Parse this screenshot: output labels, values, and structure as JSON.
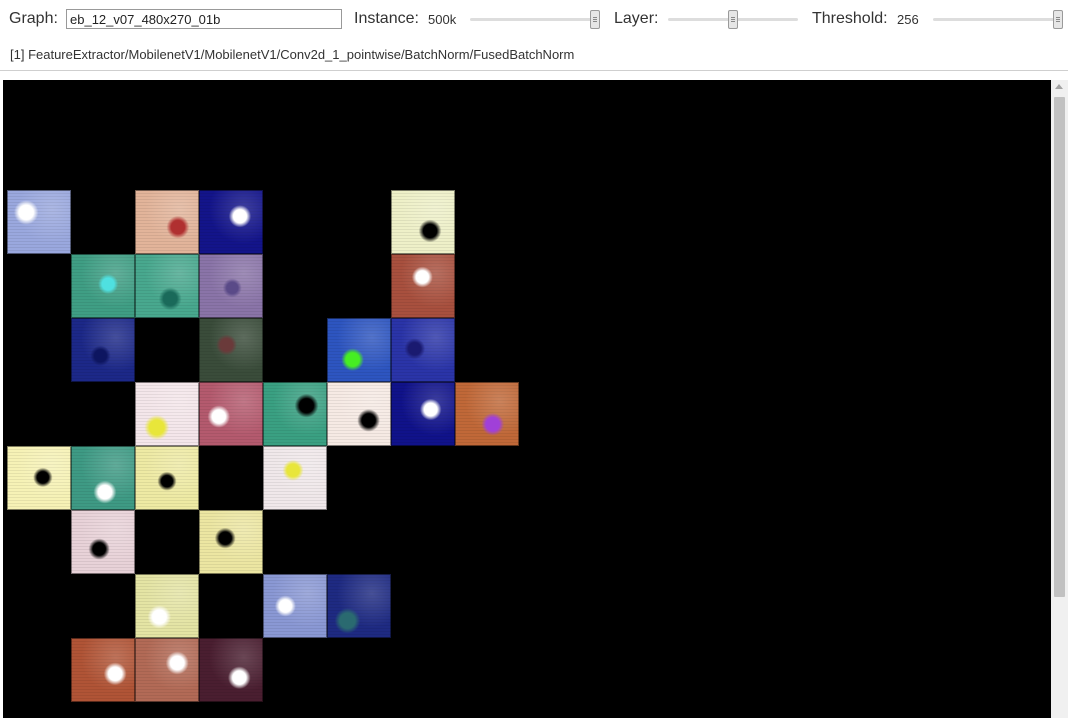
{
  "toolbar": {
    "graph_label": "Graph:",
    "graph_value": "eb_12_v07_480x270_01b",
    "instance_label": "Instance:",
    "instance_value": "500k",
    "instance_level": 1.0,
    "layer_label": "Layer:",
    "layer_level": 0.5,
    "threshold_label": "Threshold:",
    "threshold_value": "256",
    "threshold_level": 1.0
  },
  "node_path": "[1] FeatureExtractor/MobilenetV1/MobilenetV1/Conv2d_1_pointwise/BatchNorm/FusedBatchNorm",
  "viewer": {
    "background": "#000000",
    "tiles": [
      {
        "col": 0,
        "row": 0,
        "color": "#9aa8de",
        "blot": "#ffffff"
      },
      {
        "col": 2,
        "row": 0,
        "color": "#e2b49a",
        "blot": "#b03030"
      },
      {
        "col": 3,
        "row": 0,
        "color": "#13148a",
        "blot": "#ffffff"
      },
      {
        "col": 6,
        "row": 0,
        "color": "#eef0c8",
        "blot": "#000000"
      },
      {
        "col": 1,
        "row": 1,
        "color": "#3f9e84",
        "blot": "#4fe0e0"
      },
      {
        "col": 2,
        "row": 1,
        "color": "#48a88e",
        "blot": "#1a6a5a"
      },
      {
        "col": 3,
        "row": 1,
        "color": "#8a74a8",
        "blot": "#5a4a88"
      },
      {
        "col": 6,
        "row": 1,
        "color": "#a8503e",
        "blot": "#ffffff"
      },
      {
        "col": 1,
        "row": 2,
        "color": "#1c2888",
        "blot": "#0d1560"
      },
      {
        "col": 3,
        "row": 2,
        "color": "#3a4c3a",
        "blot": "#6a3a3a"
      },
      {
        "col": 5,
        "row": 2,
        "color": "#2d55c0",
        "blot": "#46ee22"
      },
      {
        "col": 6,
        "row": 2,
        "color": "#2a34a8",
        "blot": "#1a1a70"
      },
      {
        "col": 2,
        "row": 3,
        "color": "#f4e6ea",
        "blot": "#e8e63a"
      },
      {
        "col": 3,
        "row": 3,
        "color": "#b45a6e",
        "blot": "#ffffff"
      },
      {
        "col": 4,
        "row": 3,
        "color": "#3aa082",
        "blot": "#000000"
      },
      {
        "col": 5,
        "row": 3,
        "color": "#f6eae4",
        "blot": "#000000"
      },
      {
        "col": 6,
        "row": 3,
        "color": "#10128a",
        "blot": "#ffffff"
      },
      {
        "col": 7,
        "row": 3,
        "color": "#c06838",
        "blot": "#a040d8"
      },
      {
        "col": 0,
        "row": 4,
        "color": "#f6f2b6",
        "blot": "#000000"
      },
      {
        "col": 1,
        "row": 4,
        "color": "#3e9a84",
        "blot": "#ffffff"
      },
      {
        "col": 2,
        "row": 4,
        "color": "#eeeaa4",
        "blot": "#000000"
      },
      {
        "col": 4,
        "row": 4,
        "color": "#f0e8ea",
        "blot": "#e8e63a"
      },
      {
        "col": 1,
        "row": 5,
        "color": "#e8d2d8",
        "blot": "#000000"
      },
      {
        "col": 3,
        "row": 5,
        "color": "#ece6a2",
        "blot": "#000000"
      },
      {
        "col": 2,
        "row": 6,
        "color": "#e4e4a4",
        "blot": "#ffffff"
      },
      {
        "col": 4,
        "row": 6,
        "color": "#8a98d4",
        "blot": "#ffffff"
      },
      {
        "col": 5,
        "row": 6,
        "color": "#1e2a82",
        "blot": "#2a6a70"
      },
      {
        "col": 1,
        "row": 7,
        "color": "#b05436",
        "blot": "#ffffff"
      },
      {
        "col": 2,
        "row": 7,
        "color": "#b26a56",
        "blot": "#ffffff"
      },
      {
        "col": 3,
        "row": 7,
        "color": "#4a1e30",
        "blot": "#ffffff"
      }
    ]
  }
}
